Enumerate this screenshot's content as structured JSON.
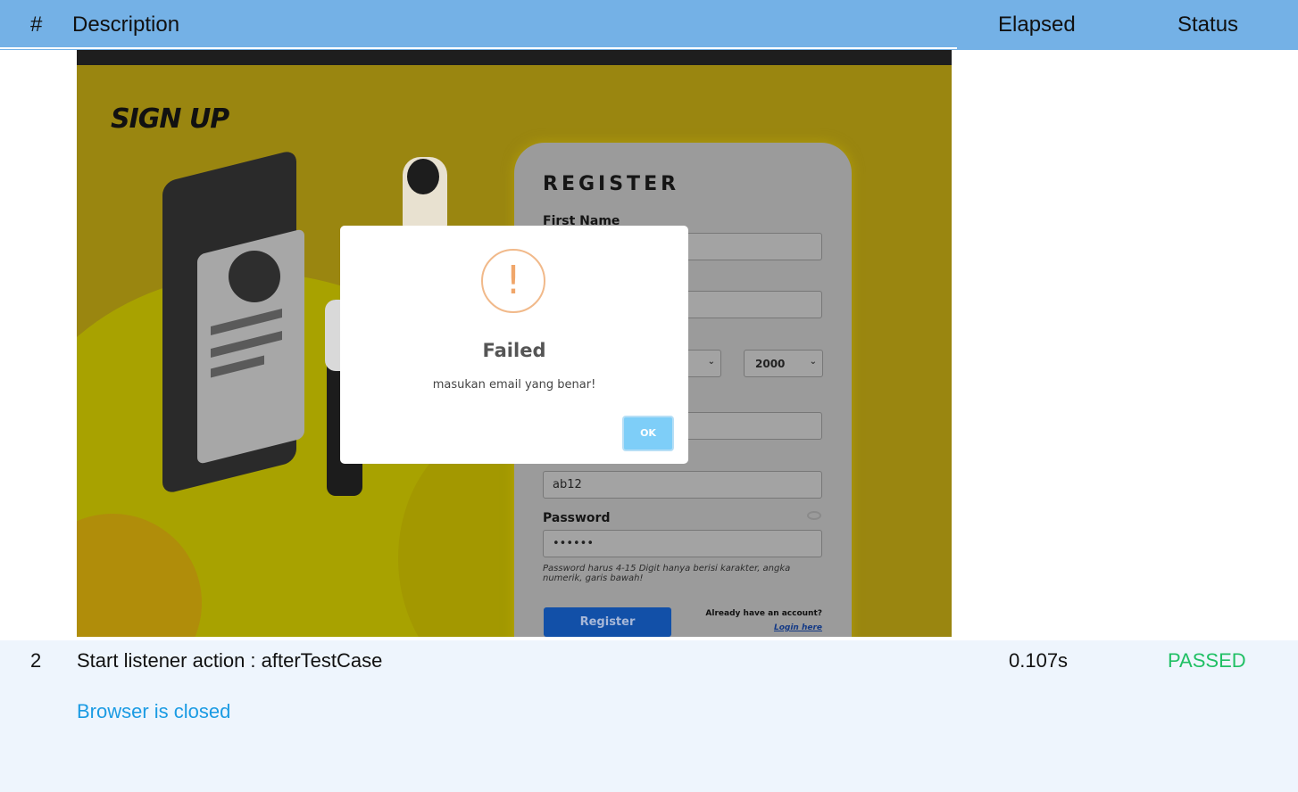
{
  "table": {
    "headers": {
      "num": "#",
      "description": "Description",
      "elapsed": "Elapsed",
      "status": "Status"
    },
    "rows": [
      {
        "num": "2",
        "description": "Start listener action : afterTestCase",
        "elapsed": "0.107s",
        "status": "PASSED",
        "note": "Browser is closed"
      }
    ]
  },
  "screenshot": {
    "heading": "SIGN UP",
    "register_title": "REGISTER",
    "first_name_label": "First Name",
    "year_value": "2000",
    "username_value": "ab12",
    "password_label": "Password",
    "password_value": "••••••",
    "password_hint": "Password harus 4-15 Digit hanya berisi karakter, angka numerik, garis bawah!",
    "register_button": "Register",
    "already_text": "Already have an account?",
    "login_link": "Login here",
    "dialog": {
      "title": "Failed",
      "message": "masukan email yang benar!",
      "ok": "OK"
    }
  },
  "colors": {
    "header_bg": "#74b1e6",
    "passed": "#21c065",
    "note_link": "#1b9be3",
    "row_bg": "#eef5fd"
  },
  "icons": {
    "warning": "warning-icon",
    "eye": "eye-icon",
    "chevron": "chevron-down-icon"
  }
}
